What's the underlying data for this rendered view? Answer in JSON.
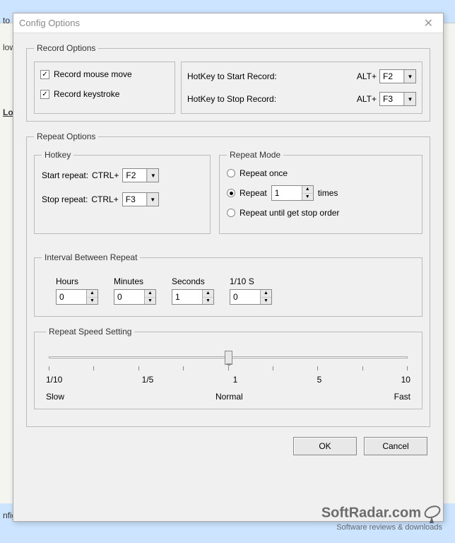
{
  "window": {
    "title": "Config Options"
  },
  "behind": {
    "partial1": "to C",
    "partial2": "low",
    "partial3": "Lo",
    "partial4": "nfig"
  },
  "record": {
    "legend": "Record Options",
    "mouse_label": "Record mouse move",
    "keystroke_label": "Record keystroke",
    "start_label": "HotKey to Start Record:",
    "stop_label": "HotKey to Stop Record:",
    "prefix": "ALT+",
    "start_key": "F2",
    "stop_key": "F3"
  },
  "repeat": {
    "legend": "Repeat Options",
    "hotkey_legend": "Hotkey",
    "start_label": "Start repeat:",
    "stop_label": "Stop repeat:",
    "prefix": "CTRL+",
    "start_key": "F2",
    "stop_key": "F3",
    "mode_legend": "Repeat Mode",
    "once_label": "Repeat once",
    "repeat_label": "Repeat",
    "repeat_count": "1",
    "times_label": "times",
    "until_label": "Repeat until get stop order"
  },
  "interval": {
    "legend": "Interval Between Repeat",
    "hours_label": "Hours",
    "minutes_label": "Minutes",
    "seconds_label": "Seconds",
    "tenths_label": "1/10 S",
    "hours": "0",
    "minutes": "0",
    "seconds": "1",
    "tenths": "0"
  },
  "speed": {
    "legend": "Repeat Speed Setting",
    "tick1": "1/10",
    "tick2": "1/5",
    "tick3": "1",
    "tick4": "5",
    "tick5": "10",
    "slow": "Slow",
    "normal": "Normal",
    "fast": "Fast"
  },
  "buttons": {
    "ok": "OK",
    "cancel": "Cancel"
  },
  "watermark": {
    "brand": "SoftRadar.com",
    "tagline": "Software reviews & downloads"
  }
}
